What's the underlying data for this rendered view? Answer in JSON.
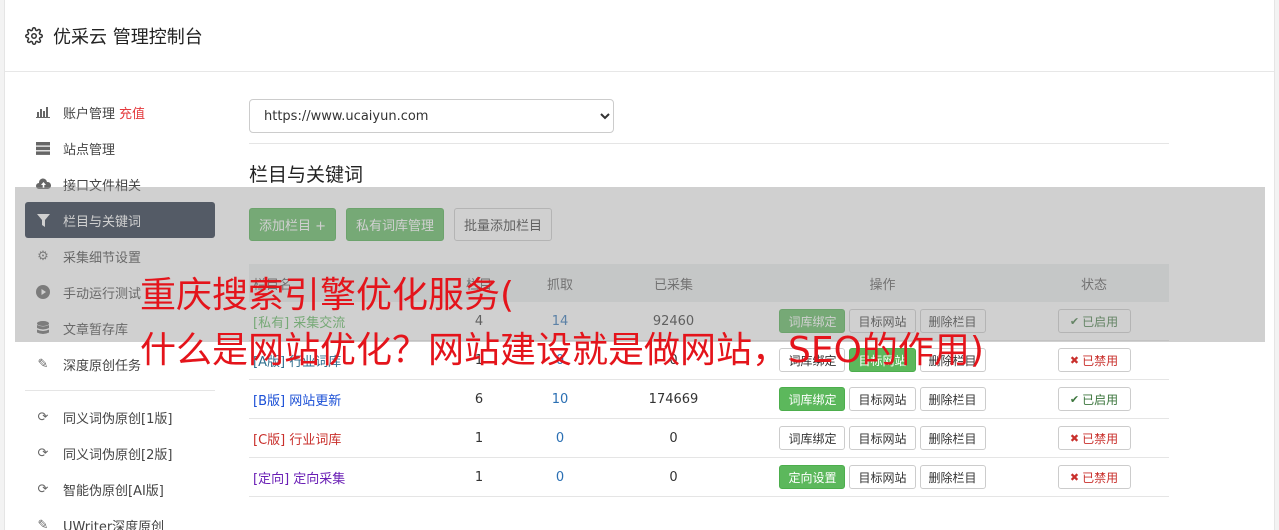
{
  "app": {
    "title": "优采云 管理控制台"
  },
  "sidebar": {
    "items": [
      {
        "label": "账户管理",
        "extra": "充值",
        "icon": "bar-chart-icon"
      },
      {
        "label": "站点管理",
        "icon": "server-icon"
      },
      {
        "label": "接口文件相关",
        "icon": "cloud-upload-icon"
      },
      {
        "label": "栏目与关键词",
        "icon": "filter-icon",
        "active": true
      },
      {
        "label": "采集细节设置",
        "icon": "cogs-icon"
      },
      {
        "label": "手动运行测试",
        "icon": "play-circle-icon"
      },
      {
        "label": "文章暂存库",
        "icon": "database-icon"
      },
      {
        "label": "深度原创任务",
        "icon": "edit-icon"
      },
      {
        "label": "同义词伪原创[1版]",
        "icon": "refresh-icon"
      },
      {
        "label": "同义词伪原创[2版]",
        "icon": "refresh-icon"
      },
      {
        "label": "智能伪原创[AI版]",
        "icon": "refresh-icon"
      },
      {
        "label": "UWriter深度原创",
        "icon": "edit-icon"
      }
    ]
  },
  "main": {
    "site_select": {
      "value": "https://www.ucaiyun.com"
    },
    "section_title": "栏目与关键词",
    "buttons": {
      "add_column": "添加栏目 +",
      "private_lib": "私有词库管理",
      "batch_add": "批量添加栏目"
    },
    "table": {
      "headers": {
        "c1": "栏目名",
        "c2": "栏目",
        "c3": "抓取",
        "c4": "已采集",
        "c5": "操作",
        "c6": "状态"
      },
      "rows": [
        {
          "tag": "[私有]",
          "name": "采集交流",
          "col": "4",
          "fetch": "14",
          "collected": "92460",
          "bind": "词库绑定",
          "target": "目标网站",
          "delete": "删除栏目",
          "status": "已启用"
        },
        {
          "tag": "[A版]",
          "name": "行业词库",
          "col": "1",
          "fetch": "0",
          "collected": "0",
          "bind": "词库绑定",
          "target": "目标网站",
          "delete": "删除栏目",
          "status": "已禁用"
        },
        {
          "tag": "[B版]",
          "name": "网站更新",
          "col": "6",
          "fetch": "10",
          "collected": "174669",
          "bind": "词库绑定",
          "target": "目标网站",
          "delete": "删除栏目",
          "status": "已启用"
        },
        {
          "tag": "[C版]",
          "name": "行业词库",
          "col": "1",
          "fetch": "0",
          "collected": "0",
          "bind": "词库绑定",
          "target": "目标网站",
          "delete": "删除栏目",
          "status": "已禁用"
        },
        {
          "tag": "[定向]",
          "name": "定向采集",
          "col": "1",
          "fetch": "0",
          "collected": "0",
          "bind": "定向设置",
          "target": "目标网站",
          "delete": "删除栏目",
          "status": "已禁用"
        }
      ]
    }
  },
  "overlay": {
    "line1": "重庆搜索引擎优化服务(",
    "line2": "什么是网站优化？网站建设就是做网站，SEO的作用)"
  },
  "colors": {
    "accent_green": "#5cb85c",
    "sidebar_active": "#1e2a3e",
    "overlay_text": "#e4141b"
  }
}
